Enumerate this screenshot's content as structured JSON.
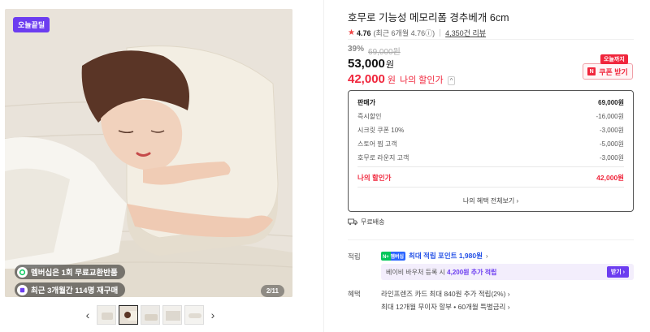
{
  "gallery": {
    "badge": "오늘끝딜",
    "chip_member": "멤버십은 1회 무료교환반품",
    "chip_repurchase": "최근 3개월간 114명 재구매",
    "pager": "2/11",
    "prev_icon": "‹",
    "next_icon": "›"
  },
  "product": {
    "title": "호무로 기능성 메모리폼 경추베개 6cm",
    "rating": "4.76",
    "rating_recent": "(최근 6개월 4.76ⓘ)",
    "reviews": "4,350건 리뷰"
  },
  "price": {
    "discount_rate": "39%",
    "original": "69,000원",
    "sale": "53,000",
    "won": "원",
    "my_price": "42,000",
    "my_label": "나의 할인가",
    "caret": "^"
  },
  "coupon": {
    "tag": "오늘까지",
    "icon": "N",
    "label": "쿠폰 받기"
  },
  "breakdown": {
    "rows": [
      {
        "label": "판매가",
        "value": "69,000원"
      },
      {
        "label": "즉시할인",
        "value": "-16,000원"
      },
      {
        "label": "시크릿 쿠폰 10%",
        "value": "-3,000원"
      },
      {
        "label": "스토어 찜 고객",
        "value": "-5,000원"
      },
      {
        "label": "호무로 라운지 고객",
        "value": "-3,000원"
      }
    ],
    "total_label": "나의 할인가",
    "total_value": "42,000원",
    "all_link": "나의 혜택 전체보기 ›"
  },
  "delivery": {
    "label": "무료배송"
  },
  "points": {
    "row_label": "적립",
    "badge": "N+ 멤버십",
    "max_text": "최대 적립 포인트 1,980원",
    "chevron": "›",
    "bubble_prefix": "베이비 바우처 등록 시",
    "bubble_highlight": "4,200원 추가 적립",
    "bubble_button": "받기 ›"
  },
  "benefits": {
    "row_label": "혜택",
    "line1": "라인프렌즈 카드 최대 840원 추가 적립(2%) ›",
    "line2": "최대 12개월 무이자 할부 • 60개월 특별금리 ›"
  },
  "colors": {
    "accent_red": "#f0263c",
    "accent_purple": "#6c3df0",
    "accent_blue": "#2350e6",
    "naver_green": "#03c75a"
  }
}
